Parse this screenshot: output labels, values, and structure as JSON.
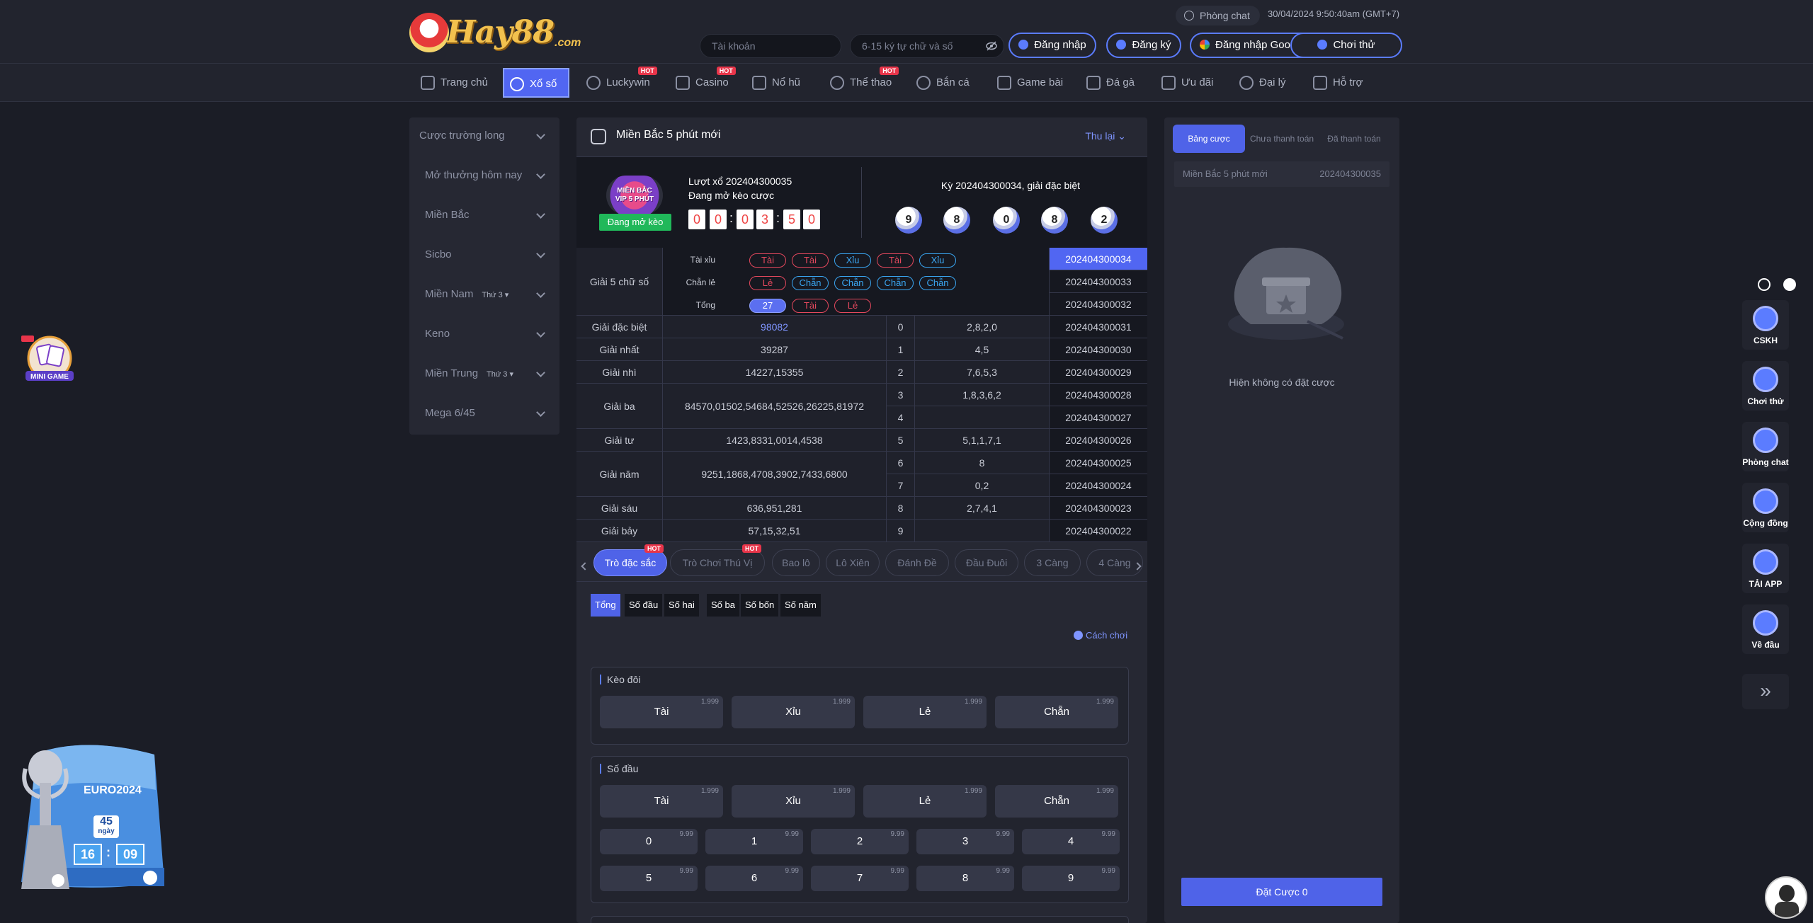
{
  "header": {
    "logo_text": "Hay88",
    "logo_suffix": ".com",
    "chat_label": "Phòng chat",
    "datetime": "30/04/2024 9:50:40am  (GMT+7)",
    "username_placeholder": "Tài khoản",
    "password_placeholder": "6-15 ký tự chữ và số",
    "login": "Đăng nhập",
    "register": "Đăng ký",
    "google_login": "Đăng nhập Google",
    "try": "Chơi thử"
  },
  "nav": [
    {
      "label": "Trang chủ",
      "hot": ""
    },
    {
      "label": "Xổ số",
      "hot": ""
    },
    {
      "label": "Luckywin",
      "hot": "HOT"
    },
    {
      "label": "Casino",
      "hot": "HOT"
    },
    {
      "label": "Nổ hũ",
      "hot": ""
    },
    {
      "label": "Thể thao",
      "hot": "HOT"
    },
    {
      "label": "Bắn cá",
      "hot": ""
    },
    {
      "label": "Game bài",
      "hot": ""
    },
    {
      "label": "Đá gà",
      "hot": ""
    },
    {
      "label": "Ưu đãi",
      "hot": ""
    },
    {
      "label": "Đại lý",
      "hot": ""
    },
    {
      "label": "Hỗ trợ",
      "hot": ""
    }
  ],
  "sidebar": [
    {
      "label": "Cược trường long",
      "sub": ""
    },
    {
      "label": "Mở thưởng hôm nay",
      "sub": ""
    },
    {
      "label": "Miền Bắc",
      "sub": ""
    },
    {
      "label": "Sicbo",
      "sub": ""
    },
    {
      "label": "Miền Nam",
      "sub": "Thứ 3 ▾"
    },
    {
      "label": "Keno",
      "sub": ""
    },
    {
      "label": "Miền Trung",
      "sub": "Thứ 3 ▾"
    },
    {
      "label": "Mega 6/45",
      "sub": ""
    }
  ],
  "game": {
    "title": "Miền Bắc 5 phút mới",
    "collapse": "Thu lại",
    "badge_text": "MIỀN BẮC VIP 5 PHÚT",
    "status_button": "Đang mở kèo",
    "draw_line1": "Lượt xổ 202404300035",
    "draw_line2": "Đang mở kèo cược",
    "countdown": [
      "0",
      "0",
      "0",
      "3",
      "5",
      "0"
    ],
    "last_result_title": "Kỳ 202404300034, giải đặc biệt",
    "balls": [
      "9",
      "8",
      "0",
      "8",
      "2"
    ]
  },
  "results": {
    "five_digit_label": "Giải 5 chữ số",
    "tx_label": "Tài xỉu",
    "cl_label": "Chẵn lẻ",
    "tong_label": "Tổng",
    "tx": [
      {
        "t": "Tài",
        "c": "r"
      },
      {
        "t": "Tài",
        "c": "r"
      },
      {
        "t": "Xỉu",
        "c": "b"
      },
      {
        "t": "Tài",
        "c": "r"
      },
      {
        "t": "Xỉu",
        "c": "b"
      }
    ],
    "cl": [
      {
        "t": "Lẻ",
        "c": "r"
      },
      {
        "t": "Chẵn",
        "c": "b"
      },
      {
        "t": "Chẵn",
        "c": "b"
      },
      {
        "t": "Chẵn",
        "c": "b"
      },
      {
        "t": "Chẵn",
        "c": "b"
      }
    ],
    "tong": [
      {
        "t": "27",
        "c": "sel"
      },
      {
        "t": "Tài",
        "c": "r"
      },
      {
        "t": "Lẻ",
        "c": "r"
      }
    ],
    "prizes": [
      {
        "name": "Giải đặc biệt",
        "value": "98082"
      },
      {
        "name": "Giải nhất",
        "value": "39287"
      },
      {
        "name": "Giải nhì",
        "value": "14227,15355"
      },
      {
        "name": "Giải ba",
        "value": "84570,01502,54684,52526,26225,81972"
      },
      {
        "name": "Giải tư",
        "value": "1423,8331,0014,4538"
      },
      {
        "name": "Giải năm",
        "value": "9251,1868,4708,3902,7433,6800"
      },
      {
        "name": "Giải sáu",
        "value": "636,951,281"
      },
      {
        "name": "Giải bảy",
        "value": "57,15,32,51"
      }
    ],
    "heads": [
      {
        "d": "0",
        "v": "2,8,2,0"
      },
      {
        "d": "1",
        "v": "4,5"
      },
      {
        "d": "2",
        "v": "7,6,5,3"
      },
      {
        "d": "3",
        "v": "1,8,3,6,2"
      },
      {
        "d": "4",
        "v": ""
      },
      {
        "d": "5",
        "v": "5,1,1,7,1"
      },
      {
        "d": "6",
        "v": "8"
      },
      {
        "d": "7",
        "v": "0,2"
      },
      {
        "d": "8",
        "v": "2,7,4,1"
      },
      {
        "d": "9",
        "v": ""
      }
    ],
    "issues": [
      "202404300034",
      "202404300033",
      "202404300032",
      "202404300031",
      "202404300030",
      "202404300029",
      "202404300028",
      "202404300027",
      "202404300026",
      "202404300025",
      "202404300024",
      "202404300023",
      "202404300022"
    ]
  },
  "bet_tabs": [
    {
      "label": "Trò đặc sắc",
      "hot": "HOT"
    },
    {
      "label": "Trò Chơi Thú Vị",
      "hot": "HOT"
    },
    {
      "label": "Bao lô",
      "hot": ""
    },
    {
      "label": "Lô Xiên",
      "hot": ""
    },
    {
      "label": "Đánh Đề",
      "hot": ""
    },
    {
      "label": "Đầu Đuôi",
      "hot": ""
    },
    {
      "label": "3 Càng",
      "hot": ""
    },
    {
      "label": "4 Càng",
      "hot": ""
    }
  ],
  "sub_tabs": [
    "Tổng",
    "Số đầu",
    "Số hai",
    "Số ba",
    "Số bốn",
    "Số năm"
  ],
  "how_to": "Cách chơi",
  "keo_doi": {
    "title": "Kèo đôi",
    "options": [
      {
        "l": "Tài",
        "o": "1.999"
      },
      {
        "l": "Xỉu",
        "o": "1.999"
      },
      {
        "l": "Lẻ",
        "o": "1.999"
      },
      {
        "l": "Chẵn",
        "o": "1.999"
      }
    ]
  },
  "so_dau": {
    "title": "Số đầu",
    "options": [
      {
        "l": "Tài",
        "o": "1.999"
      },
      {
        "l": "Xỉu",
        "o": "1.999"
      },
      {
        "l": "Lẻ",
        "o": "1.999"
      },
      {
        "l": "Chẵn",
        "o": "1.999"
      }
    ],
    "digits": [
      {
        "l": "0",
        "o": "9.99"
      },
      {
        "l": "1",
        "o": "9.99"
      },
      {
        "l": "2",
        "o": "9.99"
      },
      {
        "l": "3",
        "o": "9.99"
      },
      {
        "l": "4",
        "o": "9.99"
      },
      {
        "l": "5",
        "o": "9.99"
      },
      {
        "l": "6",
        "o": "9.99"
      },
      {
        "l": "7",
        "o": "9.99"
      },
      {
        "l": "8",
        "o": "9.99"
      },
      {
        "l": "9",
        "o": "9.99"
      }
    ]
  },
  "bet_panel": {
    "tabs": [
      "Bảng cược",
      "Chưa thanh toán",
      "Đã thanh toán"
    ],
    "game_name": "Miền Bắc 5 phút mới",
    "round": "202404300035",
    "empty": "Hiện không có đặt cược",
    "submit": "Đặt Cược 0"
  },
  "promo": {
    "minigame": "MINI GAME",
    "euro_title": "EURO2024",
    "days": "45",
    "days_unit": "ngày",
    "hours": "16",
    "minutes": "09"
  },
  "side_tools": [
    "CSKH",
    "Chơi thử",
    "Phòng chat",
    "Cộng đồng",
    "TẢI APP",
    "Về đầu"
  ],
  "colors": {
    "accent": "#4f63e8",
    "tai": "#e4485d",
    "xiu": "#3aa6f2",
    "open": "#20b85a"
  }
}
